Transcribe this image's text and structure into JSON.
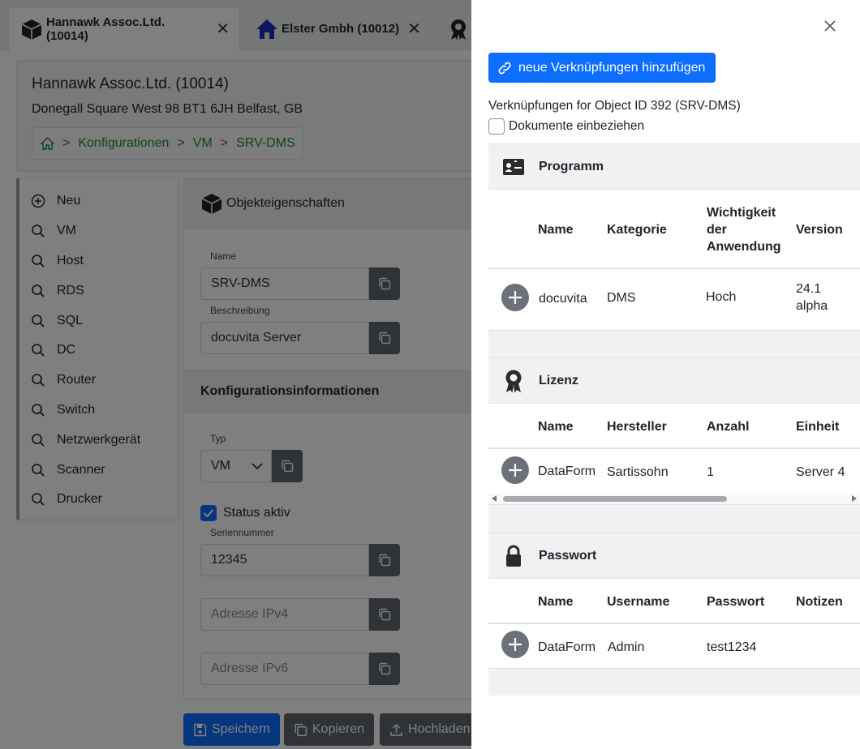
{
  "tabs": [
    {
      "label": "Hannawk Assoc.Ltd. (10014)",
      "icon": "box-icon",
      "active": true
    },
    {
      "label": "Elster Gmbh (10012)",
      "icon": "house-icon",
      "active": false
    },
    {
      "label": "",
      "icon": "award-icon",
      "active": false
    }
  ],
  "header": {
    "company": "Hannawk Assoc.Ltd. (10014)",
    "address": "Donegall Square West 98 BT1 6JH Belfast, GB",
    "breadcrumb": [
      "Konfigurationen",
      "VM",
      "SRV-DMS"
    ]
  },
  "sidenav": {
    "items": [
      {
        "label": "Neu",
        "icon": "plus-circle-icon"
      },
      {
        "label": "VM",
        "icon": "search-icon"
      },
      {
        "label": "Host",
        "icon": "search-icon"
      },
      {
        "label": "RDS",
        "icon": "search-icon"
      },
      {
        "label": "SQL",
        "icon": "search-icon"
      },
      {
        "label": "DC",
        "icon": "search-icon"
      },
      {
        "label": "Router",
        "icon": "search-icon"
      },
      {
        "label": "Switch",
        "icon": "search-icon"
      },
      {
        "label": "Netzwerkgerät",
        "icon": "search-icon"
      },
      {
        "label": "Scanner",
        "icon": "search-icon"
      },
      {
        "label": "Drucker",
        "icon": "search-icon"
      }
    ]
  },
  "props": {
    "title": "Objekteigenschaften",
    "name_label": "Name",
    "name_value": "SRV-DMS",
    "desc_label": "Beschreibung",
    "desc_value": "docuvita Server",
    "config_title": "Konfigurationsinformationen",
    "type_label": "Typ",
    "type_value": "VM",
    "status_label": "Status aktiv",
    "status_checked": true,
    "serial_label": "Seriennummer",
    "serial_value": "12345",
    "ipv4_placeholder": "Adresse IPv4",
    "ipv6_placeholder": "Adresse IPv6"
  },
  "footer": {
    "save": "Speichern",
    "copy": "Kopieren",
    "upload": "Hochladen"
  },
  "panel": {
    "add_button": "neue Verknüpfungen hinzufügen",
    "info": "Verknüpfungen for Object ID 392 (SRV-DMS)",
    "include_docs": "Dokumente einbeziehen",
    "include_docs_checked": false,
    "sections": {
      "programm": {
        "title": "Programm",
        "icon": "id-card-icon",
        "headers": [
          "Name",
          "Kategorie",
          "Wichtigkeit",
          "der",
          "Anwendung",
          "Version"
        ],
        "row": {
          "name": "docuvita",
          "kategorie": "DMS",
          "wichtigkeit": "Hoch",
          "version_1": "24.1",
          "version_2": "alpha"
        }
      },
      "lizenz": {
        "title": "Lizenz",
        "icon": "award-icon",
        "headers": [
          "Name",
          "Hersteller",
          "Anzahl",
          "Einheit"
        ],
        "row": {
          "name": "DataForm",
          "hersteller": "Sartissohn",
          "anzahl": "1",
          "einheit": "Server 4"
        }
      },
      "passwort": {
        "title": "Passwort",
        "icon": "lock-icon",
        "headers": [
          "Name",
          "Username",
          "Passwort",
          "Notizen"
        ],
        "row": {
          "name": "DataForm",
          "username": "Admin",
          "passwort": "test1234",
          "notizen": ""
        }
      }
    }
  },
  "colors": {
    "primary": "#0d6efd",
    "breadcrumb_link": "#1c8f2d",
    "copy_button": "#5f6670",
    "overlay": "rgba(0,0,0,0.5)"
  }
}
